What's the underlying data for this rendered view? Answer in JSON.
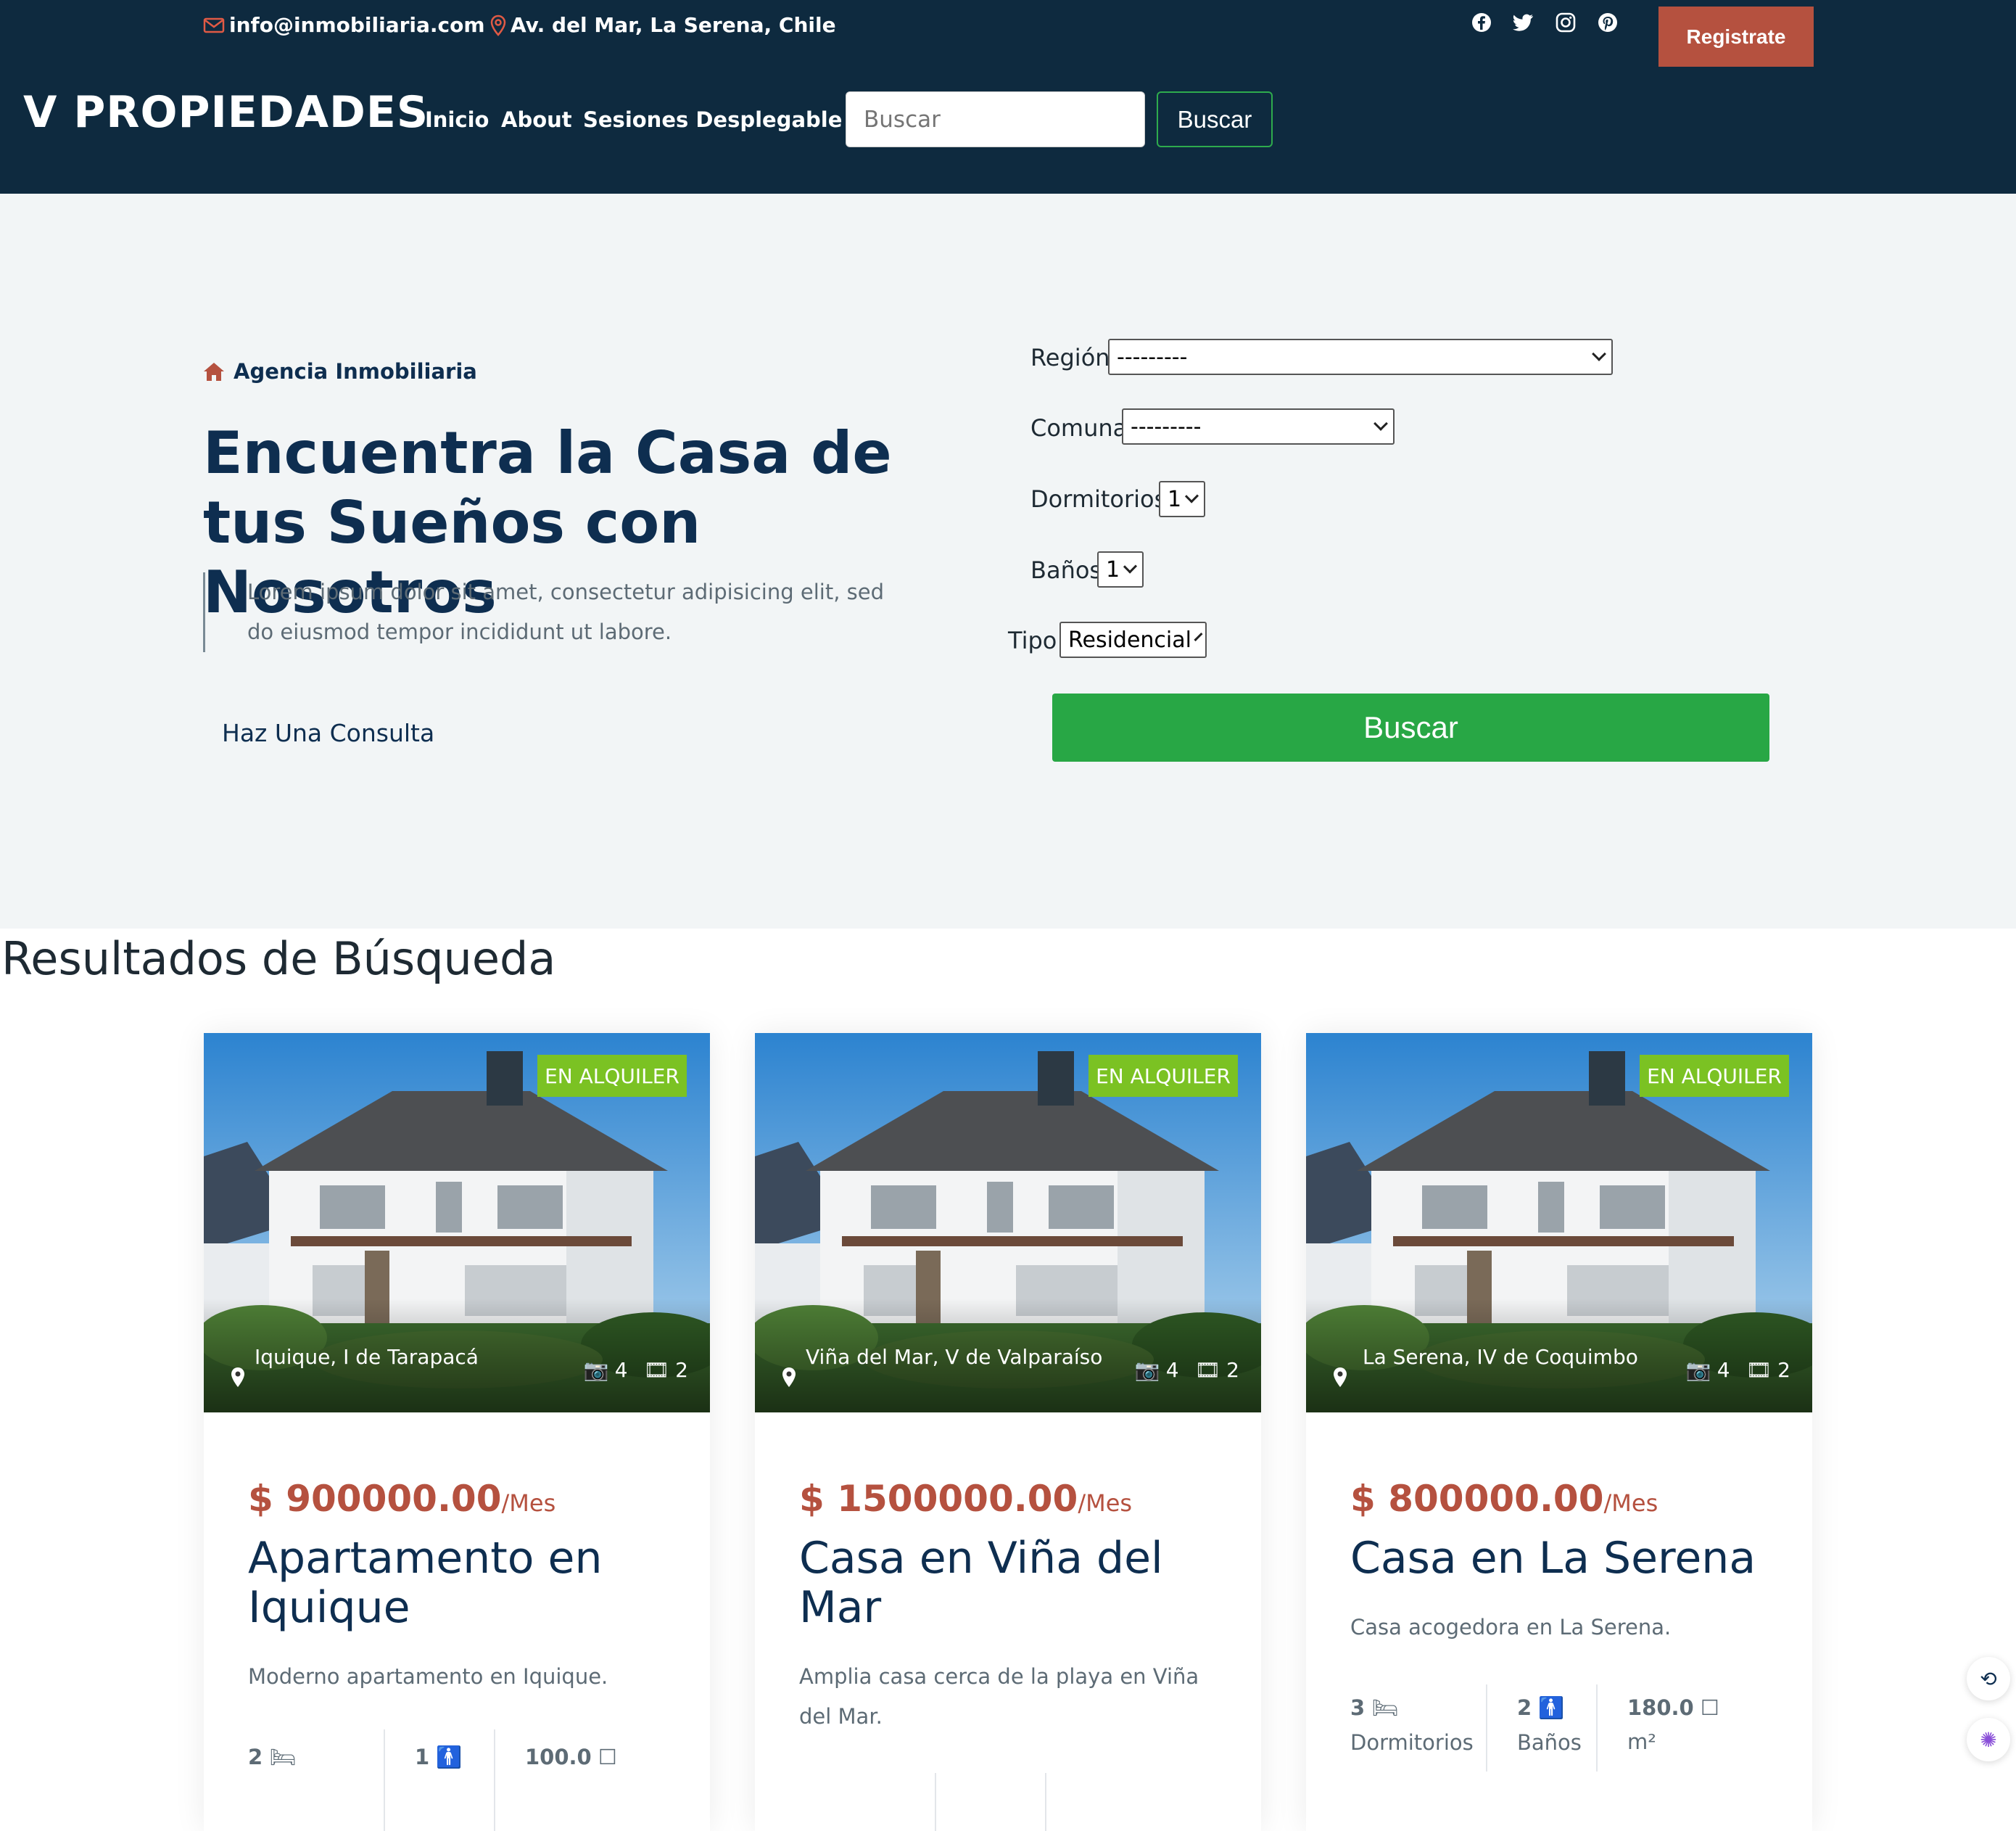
{
  "topbar": {
    "email": "info@inmobiliaria.com",
    "address": "Av. del Mar, La Serena, Chile",
    "social_icons": [
      "facebook-icon",
      "twitter-icon",
      "instagram-icon",
      "pinterest-icon"
    ],
    "register_label": "Registrate"
  },
  "navbar": {
    "brand": "V PROPIEDADES",
    "links": [
      "Inicio",
      "About",
      "Sesiones Desplegable"
    ],
    "search_placeholder": "Buscar",
    "search_button": "Buscar"
  },
  "hero": {
    "tag": "Agencia Inmobiliaria",
    "headline": "Encuentra la Casa de tus Sueños con Nosotros",
    "lead": "Lorem ipsum dolor sit amet, consectetur adipisicing elit, sed do eiusmod tempor incididunt ut labore.",
    "cta": "Haz Una Consulta"
  },
  "filters": {
    "region_label": "Región",
    "region_value": "---------",
    "comuna_label": "Comuna",
    "comuna_value": "---------",
    "dormitorios_label": "Dormitorios",
    "dormitorios_value": "1",
    "banos_label": "Baños",
    "banos_value": "1",
    "tipo_label": "Tipo",
    "tipo_value": "Residencial",
    "submit": "Buscar"
  },
  "results": {
    "title": "Resultados de Búsqueda",
    "cards": [
      {
        "badge": "EN ALQUILER",
        "location": "Iquique, I de Tarapacá",
        "photos": "4",
        "videos": "2",
        "price": "$ 900000.00",
        "period": "/Mes",
        "title": "Apartamento en Iquique",
        "desc": "Moderno apartamento en Iquique.",
        "beds": "2",
        "baths": "1",
        "area": "100.0"
      },
      {
        "badge": "EN ALQUILER",
        "location": "Viña del Mar, V de Valparaíso",
        "photos": "4",
        "videos": "2",
        "price": "$ 1500000.00",
        "period": "/Mes",
        "title": "Casa en Viña del Mar",
        "desc": "Amplia casa cerca de la playa en Viña del Mar.",
        "beds": "",
        "baths": "",
        "area": ""
      },
      {
        "badge": "EN ALQUILER",
        "location": "La Serena, IV de Coquimbo",
        "photos": "4",
        "videos": "2",
        "price": "$ 800000.00",
        "period": "/Mes",
        "title": "Casa en La Serena",
        "desc": "Casa acogedora en La Serena.",
        "beds": "3",
        "beds_label": "Dormitorios",
        "baths": "2",
        "baths_label": "Baños",
        "area": "180.0",
        "area_unit": "m²"
      }
    ]
  }
}
